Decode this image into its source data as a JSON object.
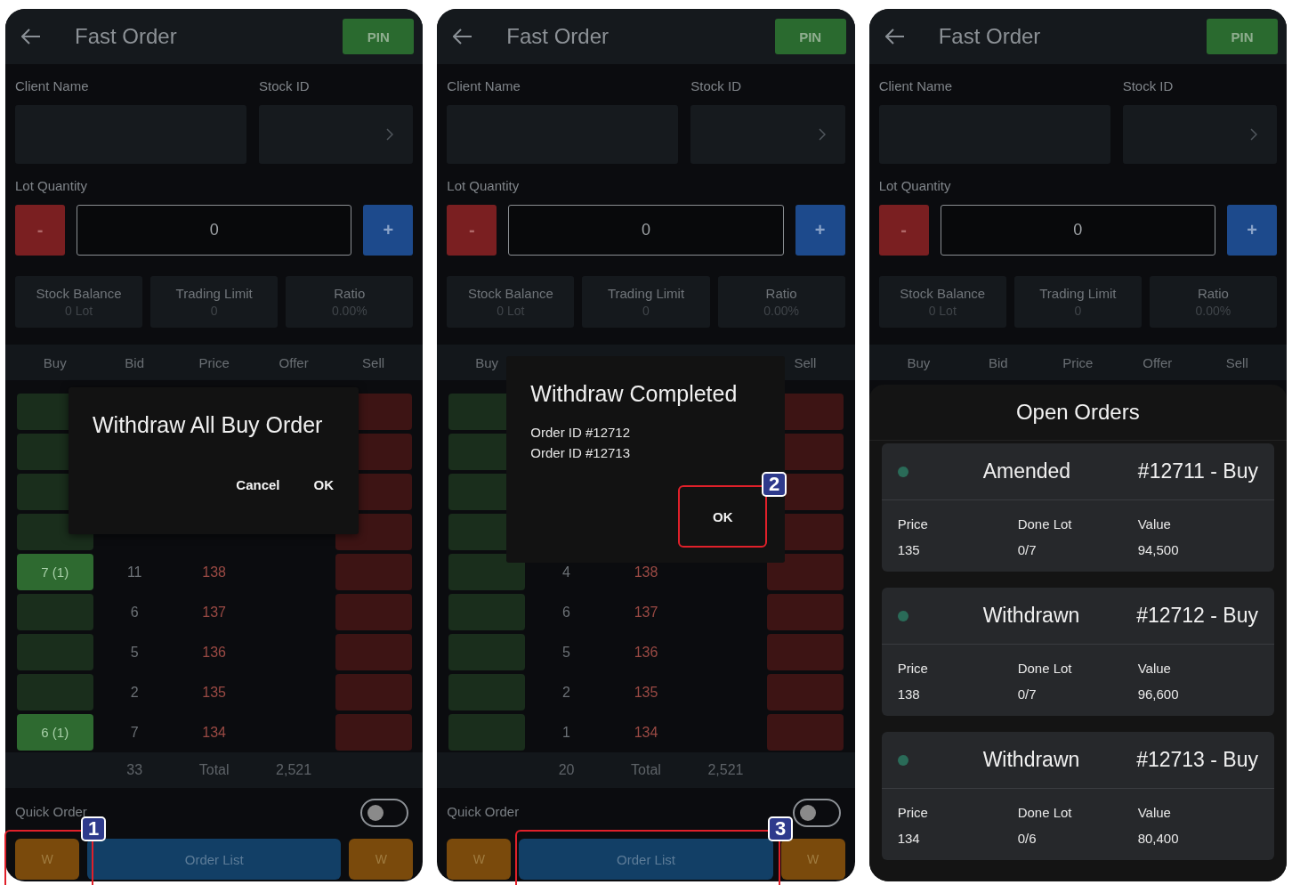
{
  "screens": [
    {
      "title": "Fast Order",
      "pin": "PIN",
      "client_label": "Client Name",
      "stock_label": "Stock ID",
      "lot_label": "Lot Quantity",
      "minus": "-",
      "quantity": "0",
      "plus": "+",
      "stats": [
        {
          "label": "Stock Balance",
          "value": "0 Lot"
        },
        {
          "label": "Trading Limit",
          "value": "0"
        },
        {
          "label": "Ratio",
          "value": "0.00%"
        }
      ],
      "columns": [
        {
          "label": "Buy"
        },
        {
          "label": "Bid"
        },
        {
          "label": "Price"
        },
        {
          "label": "Offer"
        },
        {
          "label": "Sell"
        }
      ],
      "rows": [
        {
          "active": false
        },
        {
          "active": false
        },
        {
          "active": false
        },
        {
          "active": false
        },
        {
          "buy": "7 (1)",
          "active": true,
          "bid": "11",
          "price": "138"
        },
        {
          "active": false,
          "bid": "6",
          "price": "137"
        },
        {
          "active": false,
          "bid": "5",
          "price": "136"
        },
        {
          "active": false,
          "bid": "2",
          "price": "135"
        },
        {
          "buy": "6 (1)",
          "active": true,
          "bid": "7",
          "price": "134"
        }
      ],
      "totals": {
        "bid": "33",
        "label": "Total",
        "offer": "2,521"
      },
      "quick_order": {
        "label": "Quick Order",
        "on": false
      },
      "actions": {
        "left": "W",
        "center": "Order List",
        "right": "W"
      },
      "overlay": {
        "kind": "confirm",
        "title": "Withdraw All Buy Order",
        "buttons": [
          "Cancel",
          "OK"
        ]
      }
    },
    {
      "title": "Fast Order",
      "pin": "PIN",
      "client_label": "Client Name",
      "stock_label": "Stock ID",
      "lot_label": "Lot Quantity",
      "minus": "-",
      "quantity": "0",
      "plus": "+",
      "stats": [
        {
          "label": "Stock Balance",
          "value": "0 Lot"
        },
        {
          "label": "Trading Limit",
          "value": "0"
        },
        {
          "label": "Ratio",
          "value": "0.00%"
        }
      ],
      "columns": [
        {
          "label": "Buy"
        },
        {},
        {},
        {},
        {
          "label": "Sell"
        }
      ],
      "rows": [
        {
          "active": false
        },
        {
          "active": false
        },
        {
          "active": false
        },
        {
          "active": false
        },
        {
          "active": false,
          "bid": "4",
          "price": "138"
        },
        {
          "active": false,
          "bid": "6",
          "price": "137"
        },
        {
          "active": false,
          "bid": "5",
          "price": "136"
        },
        {
          "active": false,
          "bid": "2",
          "price": "135"
        },
        {
          "active": false,
          "bid": "1",
          "price": "134"
        }
      ],
      "totals": {
        "bid": "20",
        "label": "Total",
        "offer": "2,521"
      },
      "quick_order": {
        "label": "Quick Order",
        "on": false
      },
      "actions": {
        "left": "W",
        "center": "Order List",
        "right": "W"
      },
      "overlay": {
        "kind": "notice",
        "title": "Withdraw Completed",
        "lines": [
          "Order ID #12712",
          "Order ID #12713"
        ],
        "buttons": [
          "OK"
        ]
      }
    },
    {
      "title": "Fast Order",
      "pin": "PIN",
      "client_label": "Client Name",
      "stock_label": "Stock ID",
      "lot_label": "Lot Quantity",
      "minus": "-",
      "quantity": "0",
      "plus": "+",
      "stats": [
        {
          "label": "Stock Balance",
          "value": "0 Lot"
        },
        {
          "label": "Trading Limit",
          "value": "0"
        },
        {
          "label": "Ratio",
          "value": "0.00%"
        }
      ],
      "columns": [
        {
          "label": "Buy"
        },
        {
          "label": "Bid"
        },
        {
          "label": "Price"
        },
        {
          "label": "Offer"
        },
        {
          "label": "Sell"
        }
      ],
      "overlay": {
        "kind": "sheet",
        "title": "Open Orders",
        "orders": [
          {
            "status": "Amended",
            "number": "#12711 - Buy",
            "fields": [
              {
                "label": "Price",
                "value": "135"
              },
              {
                "label": "Done Lot",
                "value": "0/7"
              },
              {
                "label": "Value",
                "value": "94,500"
              }
            ]
          },
          {
            "status": "Withdrawn",
            "number": "#12712 - Buy",
            "fields": [
              {
                "label": "Price",
                "value": "138"
              },
              {
                "label": "Done Lot",
                "value": "0/7"
              },
              {
                "label": "Value",
                "value": "96,600"
              }
            ]
          },
          {
            "status": "Withdrawn",
            "number": "#12713 - Buy",
            "fields": [
              {
                "label": "Price",
                "value": "134"
              },
              {
                "label": "Done Lot",
                "value": "0/6"
              },
              {
                "label": "Value",
                "value": "80,400"
              }
            ]
          }
        ]
      }
    }
  ],
  "callouts": [
    {
      "number": "1"
    },
    {
      "number": "2"
    },
    {
      "number": "3"
    }
  ]
}
